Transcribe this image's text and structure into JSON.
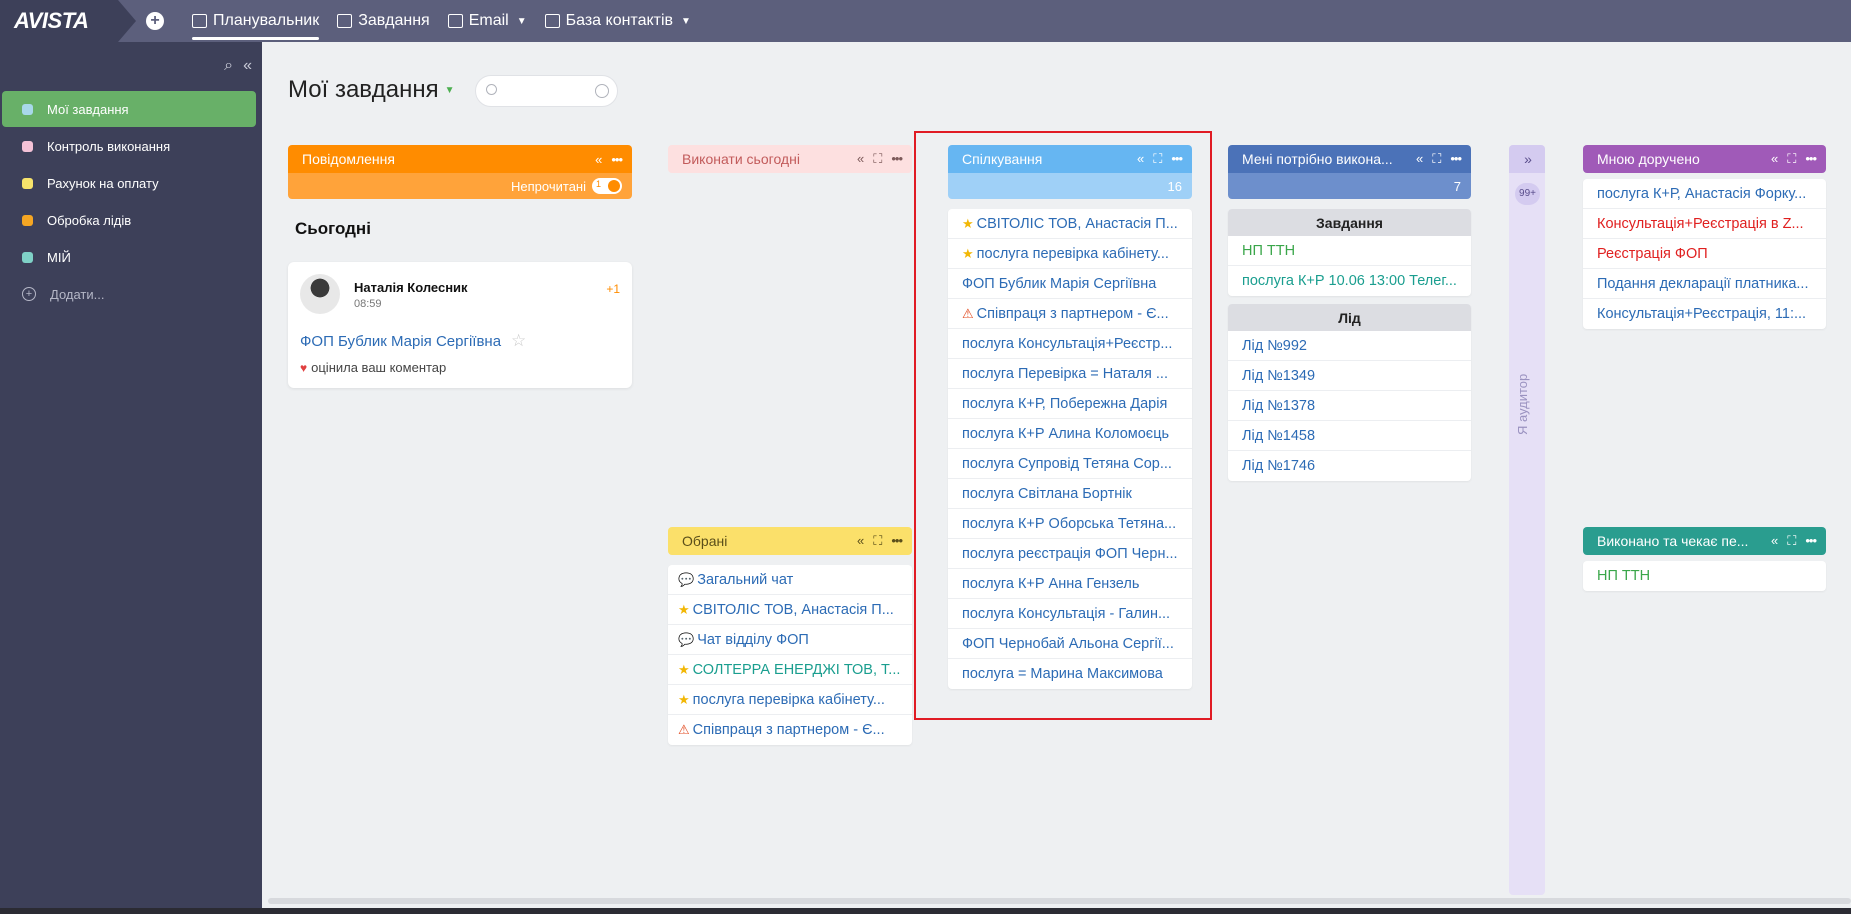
{
  "app": {
    "logo": "AVISTA"
  },
  "topnav": [
    {
      "label": "Планувальник",
      "active": true,
      "caret": false
    },
    {
      "label": "Завдання",
      "active": false,
      "caret": false
    },
    {
      "label": "Email",
      "active": false,
      "caret": true
    },
    {
      "label": "База контактів",
      "active": false,
      "caret": true
    }
  ],
  "sidebar": {
    "items": [
      {
        "label": "Мої завдання",
        "color": "#a8d8ea",
        "active": true
      },
      {
        "label": "Контроль виконання",
        "color": "#f4c2d7",
        "active": false
      },
      {
        "label": "Рахунок на оплату",
        "color": "#f7e36b",
        "active": false
      },
      {
        "label": "Обробка лідів",
        "color": "#f5a623",
        "active": false
      },
      {
        "label": "МІЙ",
        "color": "#7fd1c7",
        "active": false
      }
    ],
    "add_label": "Додати..."
  },
  "page": {
    "title": "Мої завдання"
  },
  "messages": {
    "header": "Повідомлення",
    "sub_label": "Непрочитані",
    "section": "Сьогодні",
    "card": {
      "name": "Наталія Колесник",
      "time": "08:59",
      "count": "+1",
      "link": "ФОП Бублик Марія Сергіївна",
      "action": "оцінила ваш коментар"
    }
  },
  "today": {
    "header": "Виконати сьогодні"
  },
  "favorites": {
    "header": "Обрані",
    "rows": [
      {
        "icon": "chat",
        "text": "Загальний чат",
        "color": "#2c6bb5"
      },
      {
        "icon": "star",
        "text": "СВІТОЛІС ТОВ, Анастасія П...",
        "color": "#2c6bb5"
      },
      {
        "icon": "chat",
        "text": "Чат відділу ФОП",
        "color": "#2c6bb5"
      },
      {
        "icon": "star",
        "text": "СОЛТЕРРА ЕНЕРДЖІ ТОВ, Т...",
        "color": "#1a9e8f"
      },
      {
        "icon": "star",
        "text": "послуга перевірка кабінету...",
        "color": "#2c6bb5"
      },
      {
        "icon": "warn",
        "text": "Співпраця з партнером - Є...",
        "color": "#2c6bb5"
      }
    ]
  },
  "communication": {
    "header": "Спілкування",
    "count": "16",
    "rows": [
      {
        "icon": "star",
        "text": "СВІТОЛІС ТОВ, Анастасія П..."
      },
      {
        "icon": "star",
        "text": "послуга перевірка кабінету..."
      },
      {
        "icon": "",
        "text": "ФОП Бублик Марія Сергіївна"
      },
      {
        "icon": "warn",
        "text": "Співпраця з партнером - Є..."
      },
      {
        "icon": "",
        "text": "послуга Консультація+Реєстр..."
      },
      {
        "icon": "",
        "text": "послуга Перевірка = Наталя ..."
      },
      {
        "icon": "",
        "text": "послуга К+Р, Побережна Дарія"
      },
      {
        "icon": "",
        "text": "послуга К+Р Алина Коломоєць"
      },
      {
        "icon": "",
        "text": "послуга Супровід Тетяна Сор..."
      },
      {
        "icon": "",
        "text": "послуга Світлана Бортнік"
      },
      {
        "icon": "",
        "text": "послуга К+Р Оборська Тетяна..."
      },
      {
        "icon": "",
        "text": "послуга реєстрація ФОП Черн..."
      },
      {
        "icon": "",
        "text": "послуга К+Р Анна Гензель"
      },
      {
        "icon": "",
        "text": "послуга Консультація - Галин..."
      },
      {
        "icon": "",
        "text": "ФОП Чернобай Альона Сергії..."
      },
      {
        "icon": "",
        "text": "послуга = Марина Максимова"
      }
    ]
  },
  "need_to_do": {
    "header": "Мені потрібно викона...",
    "count": "7",
    "groups": [
      {
        "title": "Завдання",
        "rows": [
          {
            "text": "НП ТТН",
            "color": "#3aa64a"
          },
          {
            "text": "послуга К+Р 10.06 13:00 Телег...",
            "color": "#1a9e8f"
          }
        ]
      },
      {
        "title": "Лід",
        "rows": [
          {
            "text": "Лід №992",
            "color": "#2c6bb5"
          },
          {
            "text": "Лід №1349",
            "color": "#2c6bb5"
          },
          {
            "text": "Лід №1378",
            "color": "#2c6bb5"
          },
          {
            "text": "Лід №1458",
            "color": "#2c6bb5"
          },
          {
            "text": "Лід №1746",
            "color": "#2c6bb5"
          }
        ]
      }
    ]
  },
  "auditor": {
    "badge": "99+",
    "label": "Я аудитор"
  },
  "assigned": {
    "header": "Мною доручено",
    "rows": [
      {
        "text": "послуга К+Р, Анастасія Форку...",
        "color": "#2c6bb5"
      },
      {
        "text": "Консультація+Реєстрація в Z...",
        "color": "#e02020"
      },
      {
        "text": "Реєстрація ФОП",
        "color": "#e02020"
      },
      {
        "text": "Подання декларації платника...",
        "color": "#2c6bb5"
      },
      {
        "text": "Консультація+Реєстрація, 11:...",
        "color": "#2c6bb5"
      }
    ]
  },
  "done_waiting": {
    "header": "Виконано та чекає пе...",
    "rows": [
      {
        "text": "НП ТТН",
        "color": "#3aa64a"
      }
    ]
  },
  "colors": {
    "messages": "#ff8c00",
    "messages_sub": "#ffa33a",
    "today": "#fde0e0",
    "favorites": "#fbe06a",
    "communication": "#66b6f2",
    "communication_sub": "#9fd0f7",
    "need": "#4b72b8",
    "need_sub": "#6d8fcc",
    "assigned": "#a05ab8",
    "done": "#2a9d8f"
  }
}
